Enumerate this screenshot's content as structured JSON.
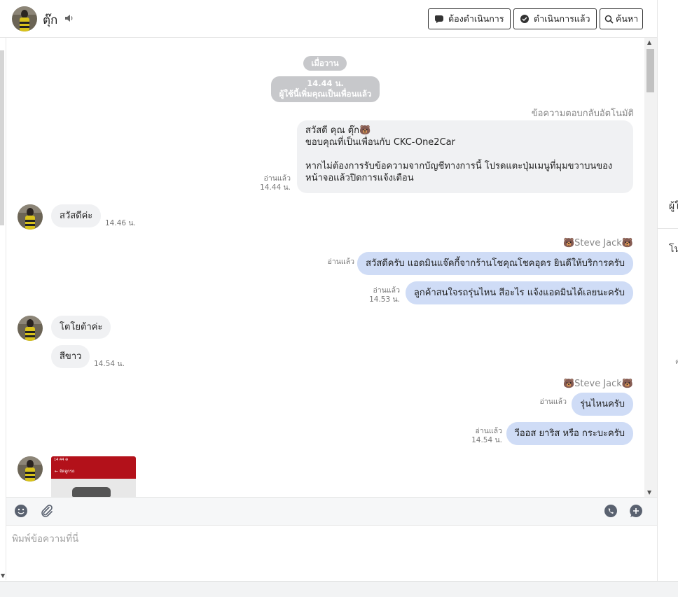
{
  "header": {
    "contact_name": "ตุ๊ก",
    "buttons": {
      "todo": "ต้องดำเนินการ",
      "done": "ดำเนินการแล้ว",
      "search": "ค้นหา"
    }
  },
  "chat": {
    "date_separator": "เมื่อวาน",
    "system_notice": {
      "time": "14.44 น.",
      "text": "ผู้ใช้นี้เพิ่มคุณเป็นเพื่อนแล้ว"
    },
    "auto_reply": {
      "label": "ข้อความตอบกลับอัตโนมัติ",
      "line1": "สวัสดี คุณ ตุ๊ก🐻",
      "line2": "ขอบคุณที่เป็นเพื่อนกับ CKC-One2Car",
      "line3": "หากไม่ต้องการรับข้อความจากบัญชีทางการนี้ โปรดแตะปุ่มเมนูที่มุมขวาบนของหน้าจอแล้วปิดการแจ้งเตือน",
      "read": "อ่านแล้ว",
      "time": "14.44 น."
    },
    "msg_in_1": {
      "text": "สวัสดีค่ะ",
      "time": "14.46 น."
    },
    "sender_1": "🐻Steve Jack🐻",
    "msg_out_1": {
      "text": "สวัสดีครับ แอดมินแจ๊คกี้จากร้านโชคุณโชคอุดร ยินดีให้บริการครับ",
      "read": "อ่านแล้ว"
    },
    "msg_out_2": {
      "text": "ลูกค้าสนใจรถรุ่นไหน สีอะไร แจ้งแอดมินได้เลยนะครับ",
      "read": "อ่านแล้ว",
      "time": "14.53 น."
    },
    "msg_in_2": {
      "text": "โตโยต้าค่ะ"
    },
    "msg_in_3": {
      "text": "สีขาว",
      "time": "14.54 น."
    },
    "sender_2": "🐻Steve Jack🐻",
    "msg_out_3": {
      "text": "รุ่นไหนครับ",
      "read": "อ่านแล้ว"
    },
    "msg_out_4": {
      "text": "วีออส ยาริส หรือ กระบะครับ",
      "read": "อ่านแล้ว",
      "time": "14.54 น."
    },
    "image_card": {
      "status": "14:44 ⊕",
      "title": "← จัดลูกรถ"
    }
  },
  "composer": {
    "placeholder": "พิมพ์ข้อความที่นี่"
  },
  "right_panel": {
    "frag1": "ผู้ใ",
    "frag2": "โน",
    "frag3": "ค"
  },
  "colors": {
    "bubble_out": "#cfdcf6",
    "bubble_in": "#f0f1f3",
    "pill": "#c7c8cb"
  }
}
